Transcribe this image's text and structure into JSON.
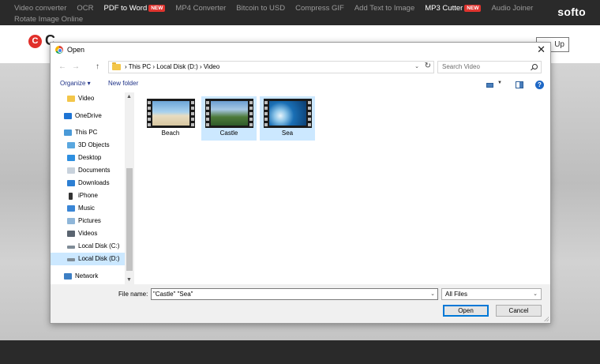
{
  "site": {
    "nav_row1": [
      {
        "label": "Video converter",
        "bright": false,
        "new": false
      },
      {
        "label": "OCR",
        "bright": false,
        "new": false
      },
      {
        "label": "PDF to Word",
        "bright": true,
        "new": true
      },
      {
        "label": "MP4 Converter",
        "bright": false,
        "new": false
      },
      {
        "label": "Bitcoin to USD",
        "bright": false,
        "new": false
      },
      {
        "label": "Compress GIF",
        "bright": false,
        "new": false
      },
      {
        "label": "Add Text to Image",
        "bright": false,
        "new": false
      },
      {
        "label": "MP3 Cutter",
        "bright": true,
        "new": true
      },
      {
        "label": "Audio Joiner",
        "bright": false,
        "new": false
      }
    ],
    "nav_row2": "Rotate Image Online",
    "new_badge": "NEW",
    "brand": "softo",
    "logo_letter": "C",
    "logo_text": "C",
    "signup_label": "Up"
  },
  "dialog": {
    "title": "Open",
    "close_glyph": "✕",
    "back_glyph": "←",
    "forward_glyph": "→",
    "up_glyph": "↑",
    "address_path": "›  This PC  ›  Local Disk (D:)  ›  Video",
    "address_dropdown": "⌄",
    "refresh_glyph": "↻",
    "search_placeholder": "Search Video",
    "organize_label": "Organize ▾",
    "new_folder_label": "New folder",
    "help_glyph": "?",
    "sidebar": [
      {
        "label": "Video",
        "icon": "folder-icon",
        "selected": false
      },
      {
        "label": "OneDrive",
        "icon": "onedrive-icon",
        "selected": false
      },
      {
        "label": "This PC",
        "icon": "computer-icon",
        "selected": false
      },
      {
        "label": "3D Objects",
        "icon": "3d-objects-icon",
        "selected": false
      },
      {
        "label": "Desktop",
        "icon": "desktop-icon",
        "selected": false
      },
      {
        "label": "Documents",
        "icon": "documents-icon",
        "selected": false
      },
      {
        "label": "Downloads",
        "icon": "downloads-icon",
        "selected": false
      },
      {
        "label": "iPhone",
        "icon": "iphone-icon",
        "selected": false
      },
      {
        "label": "Music",
        "icon": "music-icon",
        "selected": false
      },
      {
        "label": "Pictures",
        "icon": "pictures-icon",
        "selected": false
      },
      {
        "label": "Videos",
        "icon": "videos-icon",
        "selected": false
      },
      {
        "label": "Local Disk (C:)",
        "icon": "drive-icon",
        "selected": false
      },
      {
        "label": "Local Disk (D:)",
        "icon": "drive-icon",
        "selected": true
      },
      {
        "label": "Network",
        "icon": "network-icon",
        "selected": false
      }
    ],
    "files": [
      {
        "name": "Beach",
        "selected": false,
        "thumb": "beach"
      },
      {
        "name": "Castle",
        "selected": true,
        "thumb": "castle"
      },
      {
        "name": "Sea",
        "selected": true,
        "thumb": "sea"
      }
    ],
    "file_name_label": "File name:",
    "file_name_value": "\"Castle\" \"Sea\"",
    "file_type": "All Files",
    "open_label": "Open",
    "cancel_label": "Cancel"
  },
  "colors": {
    "accent": "#0078d7",
    "selection": "#cce8ff",
    "brand_red": "#e12f2a"
  }
}
